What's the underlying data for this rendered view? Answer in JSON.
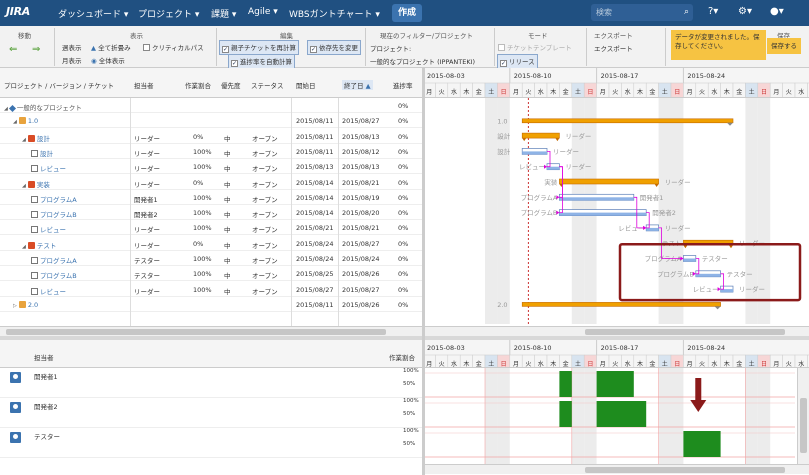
{
  "topbar": {
    "logo": "JIRA",
    "nav": [
      "ダッシュボード ▾",
      "プロジェクト ▾",
      "課題 ▾",
      "Agile ▾",
      "WBSガントチャート ▾"
    ],
    "create": "作成",
    "search_placeholder": "検索"
  },
  "toolbar": {
    "move_title": "移動",
    "view_title": "表示",
    "edit_title": "編集",
    "filter_title": "現在のフィルター/プロジェクト",
    "mode_title": "モード",
    "export_title": "エクスポート",
    "save_title": "保存",
    "week": "週表示",
    "month": "月表示",
    "collapse_all": "全て折畳み",
    "show_all": "全体表示",
    "critical_path": "クリティカルパス",
    "recalc_parent": "親子チケットを再計算",
    "change_dep": "依存先を変更",
    "auto_progress": "進捗率を自動計算",
    "project_label": "プロジェクト:",
    "project_value": "一般的なプロジェクト (IPPANTEKI)",
    "ticket_template": "チケットテンプレート",
    "release": "リリース",
    "export": "エクスポート",
    "notice": "データが変更されました。保存してください。",
    "save": "保存する"
  },
  "table": {
    "headers": [
      "プロジェクト / バージョン / チケット",
      "担当者",
      "作業割合",
      "優先度",
      "ステータス",
      "開始日",
      "終了日",
      "進捗率"
    ],
    "rows": [
      {
        "name": "一般的なプロジェクト",
        "assignee": "",
        "ratio": "",
        "priority": "",
        "status": "",
        "start": "",
        "end": "",
        "progress": "0%"
      },
      {
        "name": "1.0",
        "assignee": "",
        "ratio": "",
        "priority": "",
        "status": "",
        "start": "2015/08/11",
        "end": "2015/08/27",
        "progress": "0%"
      },
      {
        "name": "設計",
        "assignee": "リーダー",
        "ratio": "0%",
        "priority": "中",
        "status": "オープン",
        "start": "2015/08/11",
        "end": "2015/08/13",
        "progress": "0%"
      },
      {
        "name": "設計",
        "assignee": "リーダー",
        "ratio": "100%",
        "priority": "中",
        "status": "オープン",
        "start": "2015/08/11",
        "end": "2015/08/12",
        "progress": "0%"
      },
      {
        "name": "レビュー",
        "assignee": "リーダー",
        "ratio": "100%",
        "priority": "中",
        "status": "オープン",
        "start": "2015/08/13",
        "end": "2015/08/13",
        "progress": "0%"
      },
      {
        "name": "実装",
        "assignee": "リーダー",
        "ratio": "0%",
        "priority": "中",
        "status": "オープン",
        "start": "2015/08/14",
        "end": "2015/08/21",
        "progress": "0%"
      },
      {
        "name": "プログラムA",
        "assignee": "開発者1",
        "ratio": "100%",
        "priority": "中",
        "status": "オープン",
        "start": "2015/08/14",
        "end": "2015/08/19",
        "progress": "0%"
      },
      {
        "name": "プログラムB",
        "assignee": "開発者2",
        "ratio": "100%",
        "priority": "中",
        "status": "オープン",
        "start": "2015/08/14",
        "end": "2015/08/20",
        "progress": "0%"
      },
      {
        "name": "レビュー",
        "assignee": "リーダー",
        "ratio": "100%",
        "priority": "中",
        "status": "オープン",
        "start": "2015/08/21",
        "end": "2015/08/21",
        "progress": "0%"
      },
      {
        "name": "テスト",
        "assignee": "リーダー",
        "ratio": "0%",
        "priority": "中",
        "status": "オープン",
        "start": "2015/08/24",
        "end": "2015/08/27",
        "progress": "0%"
      },
      {
        "name": "プログラムA",
        "assignee": "テスター",
        "ratio": "100%",
        "priority": "中",
        "status": "オープン",
        "start": "2015/08/24",
        "end": "2015/08/24",
        "progress": "0%"
      },
      {
        "name": "プログラムB",
        "assignee": "テスター",
        "ratio": "100%",
        "priority": "中",
        "status": "オープン",
        "start": "2015/08/25",
        "end": "2015/08/26",
        "progress": "0%"
      },
      {
        "name": "レビュー",
        "assignee": "リーダー",
        "ratio": "100%",
        "priority": "中",
        "status": "オープン",
        "start": "2015/08/27",
        "end": "2015/08/27",
        "progress": "0%"
      },
      {
        "name": "2.0",
        "assignee": "",
        "ratio": "",
        "priority": "",
        "status": "",
        "start": "2015/08/11",
        "end": "2015/08/26",
        "progress": "0%"
      }
    ]
  },
  "gantt": {
    "weeks": [
      "2015-08-03",
      "2015-08-10",
      "2015-08-17",
      "2015-08-24"
    ],
    "days": [
      "月",
      "火",
      "水",
      "木",
      "金",
      "土",
      "日"
    ],
    "today": "2015-08-11",
    "labels": {
      "v10": "1.0",
      "v20": "2.0",
      "design": "設計",
      "design_sub": "設計",
      "review1": "レビュー",
      "impl": "実装",
      "progA": "プログラムA",
      "progB": "プログラムB",
      "review2": "レビュー",
      "test": "テスト",
      "testA": "プログラムA",
      "testB": "プログラムB",
      "review3": "レビュー",
      "leader": "リーダー",
      "dev1": "開発者1",
      "dev2": "開発者2",
      "tester": "テスター"
    }
  },
  "load": {
    "header_assignee": "担当者",
    "header_ratio": "作業割合",
    "rows": [
      {
        "name": "開発者1",
        "pct": [
          "100%",
          "50%"
        ]
      },
      {
        "name": "開発者2",
        "pct": [
          "100%",
          "50%"
        ]
      },
      {
        "name": "テスター",
        "pct": [
          "100%",
          "50%"
        ]
      }
    ]
  },
  "colors": {
    "header": "#205081",
    "summary": "#f0a000",
    "task": "#8eb3e6",
    "load": "#1e8c1e",
    "highlight": "#8b1a1a"
  }
}
